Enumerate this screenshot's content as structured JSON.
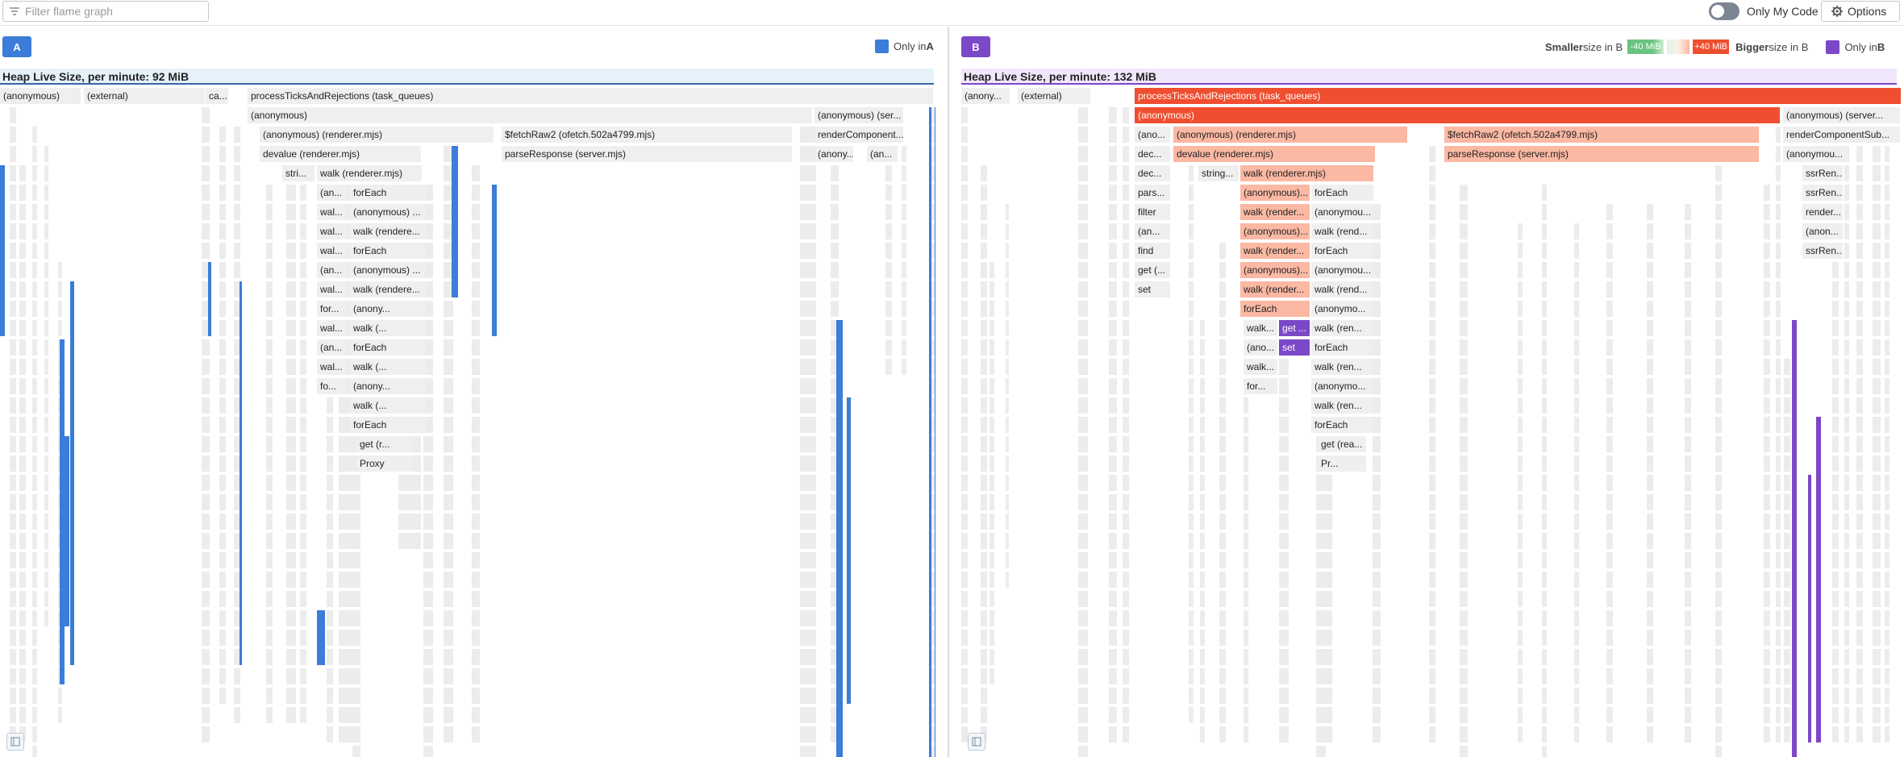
{
  "toolbar": {
    "filter_placeholder": "Filter flame graph",
    "only_my_code_label": "Only My Code",
    "only_my_code_on": false,
    "options_label": "Options"
  },
  "colors": {
    "a_blue": "#3b7dd8",
    "b_purple": "#7b48c7",
    "bigger_dark": "#f04e30",
    "bigger_light": "#fbb8a3",
    "smaller_green": "#6ac37e",
    "frame_gray": "#efefef",
    "header_a_bg": "#e5f2fa",
    "header_b_bg": "#f1e7fb"
  },
  "pane_a": {
    "button": "A",
    "legend_text": "Only in ",
    "legend_bold": "A",
    "heap_title": "Heap Live Size, per minute: 92 MiB"
  },
  "pane_b": {
    "button": "B",
    "smaller_text_bold": "Smaller",
    "smaller_text": " size in B",
    "scale_low": "-40 MiB",
    "scale_high": "+40 MiB",
    "bigger_text_bold": "Bigger",
    "bigger_text": " size in B",
    "legend_text": "Only in ",
    "legend_bold": "B",
    "heap_title": "Heap Live Size, per minute: 132 MiB"
  },
  "flame_a": {
    "frames": [
      {
        "text": "(anonymous)",
        "depth": 0
      },
      {
        "text": "(external)",
        "depth": 0
      },
      {
        "text": "ca...",
        "depth": 0
      },
      {
        "text": "processTicksAndRejections (task_queues)",
        "depth": 0
      },
      {
        "text": "(anonymous)",
        "depth": 1
      },
      {
        "text": "(anonymous) (ser...",
        "depth": 1
      },
      {
        "text": "(anonymous) (renderer.mjs)",
        "depth": 2
      },
      {
        "text": "$fetchRaw2 (ofetch.502a4799.mjs)",
        "depth": 2
      },
      {
        "text": "renderComponent...",
        "depth": 2
      },
      {
        "text": "devalue (renderer.mjs)",
        "depth": 3
      },
      {
        "text": "parseResponse (server.mjs)",
        "depth": 3
      },
      {
        "text": "(anony...",
        "depth": 3
      },
      {
        "text": "(an...",
        "depth": 3
      },
      {
        "text": "stri...",
        "depth": 4
      },
      {
        "text": "walk (renderer.mjs)",
        "depth": 4
      },
      {
        "text": "(an...",
        "depth": 5
      },
      {
        "text": "forEach",
        "depth": 5
      },
      {
        "text": "wal...",
        "depth": 6
      },
      {
        "text": "(anonymous) ...",
        "depth": 6
      },
      {
        "text": "wal...",
        "depth": 7
      },
      {
        "text": "walk (rendere...",
        "depth": 7
      },
      {
        "text": "wal...",
        "depth": 8
      },
      {
        "text": "forEach",
        "depth": 8
      },
      {
        "text": "(an...",
        "depth": 9
      },
      {
        "text": "(anonymous) ...",
        "depth": 9
      },
      {
        "text": "wal...",
        "depth": 10
      },
      {
        "text": "walk (rendere...",
        "depth": 10
      },
      {
        "text": "for...",
        "depth": 11
      },
      {
        "text": "(anony...",
        "depth": 11
      },
      {
        "text": "wal...",
        "depth": 12
      },
      {
        "text": "walk (...",
        "depth": 12
      },
      {
        "text": "(an...",
        "depth": 13
      },
      {
        "text": "forEach",
        "depth": 13
      },
      {
        "text": "wal...",
        "depth": 14
      },
      {
        "text": "walk (...",
        "depth": 14
      },
      {
        "text": "fo...",
        "depth": 15
      },
      {
        "text": "(anony...",
        "depth": 15
      },
      {
        "text": "walk (...",
        "depth": 16
      },
      {
        "text": "forEach",
        "depth": 17
      },
      {
        "text": "get (r...",
        "depth": 18
      },
      {
        "text": "Proxy",
        "depth": 19
      }
    ]
  },
  "flame_b": {
    "frames": [
      {
        "text": "(anony...",
        "depth": 0
      },
      {
        "text": "(external)",
        "depth": 0
      },
      {
        "text": "processTicksAndRejections (task_queues)",
        "depth": 0
      },
      {
        "text": "(anonymous)",
        "depth": 1
      },
      {
        "text": "(anonymous) (server...",
        "depth": 1
      },
      {
        "text": "(ano...",
        "depth": 2
      },
      {
        "text": "(anonymous) (renderer.mjs)",
        "depth": 2
      },
      {
        "text": "$fetchRaw2 (ofetch.502a4799.mjs)",
        "depth": 2
      },
      {
        "text": "renderComponentSub...",
        "depth": 2
      },
      {
        "text": "dec...",
        "depth": 3
      },
      {
        "text": "devalue (renderer.mjs)",
        "depth": 3
      },
      {
        "text": "parseResponse (server.mjs)",
        "depth": 3
      },
      {
        "text": "(anonymou...",
        "depth": 3
      },
      {
        "text": "dec...",
        "depth": 4
      },
      {
        "text": "string...",
        "depth": 4
      },
      {
        "text": "walk (renderer.mjs)",
        "depth": 4
      },
      {
        "text": "ssrRen...",
        "depth": 4
      },
      {
        "text": "pars...",
        "depth": 5
      },
      {
        "text": "(anonymous)...",
        "depth": 5
      },
      {
        "text": "forEach",
        "depth": 5
      },
      {
        "text": "ssrRen...",
        "depth": 5
      },
      {
        "text": "filter",
        "depth": 6
      },
      {
        "text": "walk (render...",
        "depth": 6
      },
      {
        "text": "(anonymou...",
        "depth": 6
      },
      {
        "text": "render...",
        "depth": 6
      },
      {
        "text": "(an...",
        "depth": 7
      },
      {
        "text": "(anonymous)...",
        "depth": 7
      },
      {
        "text": "walk (rend...",
        "depth": 7
      },
      {
        "text": "(anon...",
        "depth": 7
      },
      {
        "text": "find",
        "depth": 8
      },
      {
        "text": "walk (render...",
        "depth": 8
      },
      {
        "text": "forEach",
        "depth": 8
      },
      {
        "text": "ssrRen...",
        "depth": 8
      },
      {
        "text": "get (...",
        "depth": 9
      },
      {
        "text": "(anonymous)...",
        "depth": 9
      },
      {
        "text": "(anonymou...",
        "depth": 9
      },
      {
        "text": "set",
        "depth": 10
      },
      {
        "text": "walk (render...",
        "depth": 10
      },
      {
        "text": "walk (rend...",
        "depth": 10
      },
      {
        "text": "forEach",
        "depth": 11
      },
      {
        "text": "(anonymo...",
        "depth": 11
      },
      {
        "text": "walk...",
        "depth": 12
      },
      {
        "text": "get ...",
        "depth": 12
      },
      {
        "text": "walk (ren...",
        "depth": 12
      },
      {
        "text": "(ano...",
        "depth": 13
      },
      {
        "text": "set",
        "depth": 13
      },
      {
        "text": "forEach",
        "depth": 13
      },
      {
        "text": "walk...",
        "depth": 14
      },
      {
        "text": "walk (ren...",
        "depth": 14
      },
      {
        "text": "for...",
        "depth": 15
      },
      {
        "text": "(anonymo...",
        "depth": 15
      },
      {
        "text": "walk (ren...",
        "depth": 16
      },
      {
        "text": "forEach",
        "depth": 17
      },
      {
        "text": "get (rea...",
        "depth": 18
      },
      {
        "text": "Pr...",
        "depth": 19
      }
    ]
  }
}
